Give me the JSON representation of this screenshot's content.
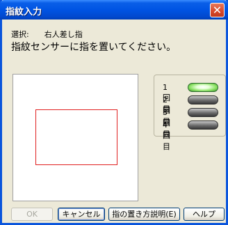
{
  "window": {
    "title": "指紋入力",
    "close_glyph": "✕"
  },
  "selection": {
    "label": "選択:",
    "finger": "右人差し指"
  },
  "instruction": "指紋センサーに指を置いてください。",
  "status": {
    "rows": [
      {
        "label": "1回目",
        "state": "active"
      },
      {
        "label": "2回目",
        "state": "inactive"
      },
      {
        "label": "3回目",
        "state": "inactive"
      },
      {
        "label": "4回目",
        "state": "inactive"
      }
    ]
  },
  "buttons": {
    "ok": "OK",
    "cancel": "キャンセル",
    "howto": "指の置き方説明(E)",
    "help": "ヘルプ"
  }
}
